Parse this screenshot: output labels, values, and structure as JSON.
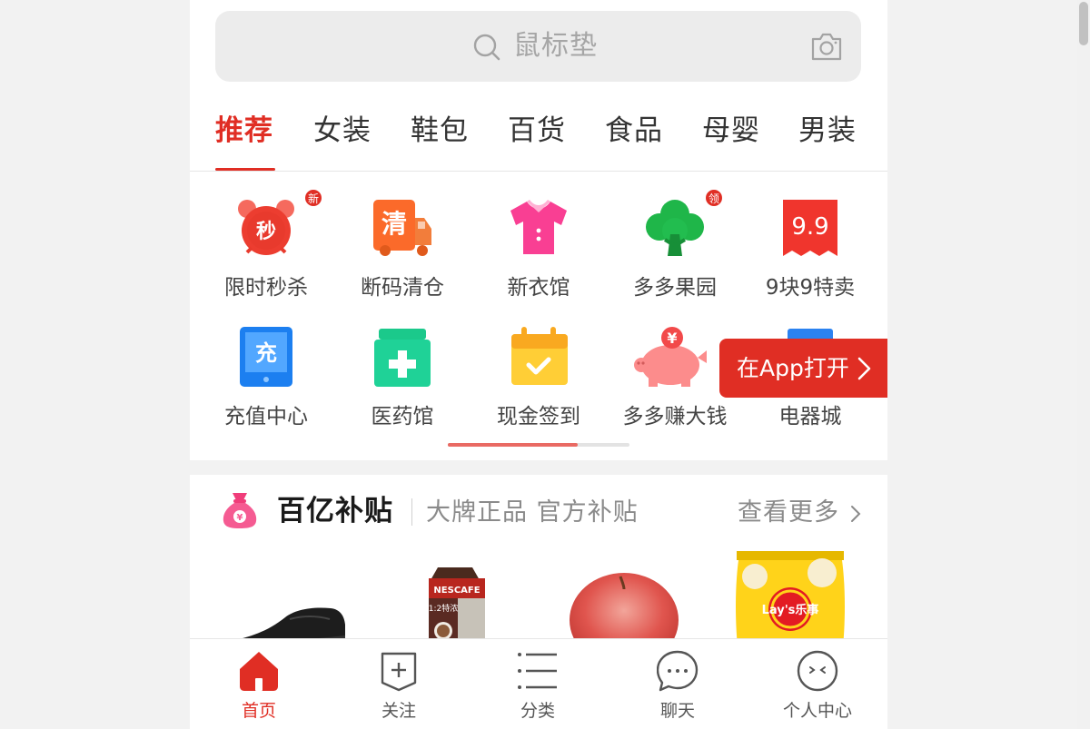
{
  "search": {
    "placeholder": "鼠标垫"
  },
  "tabs": [
    "推荐",
    "女装",
    "鞋包",
    "百货",
    "食品",
    "母婴",
    "男装"
  ],
  "grid": [
    {
      "label": "限时秒杀",
      "icon": "alarm-clock-icon",
      "icon_text": "秒",
      "badge": "新"
    },
    {
      "label": "断码清仓",
      "icon": "truck-icon",
      "icon_text": "清"
    },
    {
      "label": "新衣馆",
      "icon": "shirt-icon"
    },
    {
      "label": "多多果园",
      "icon": "tree-icon",
      "badge": "领"
    },
    {
      "label": "9块9特卖",
      "icon": "price-tag-icon",
      "icon_text": "9.9"
    },
    {
      "label": "充值中心",
      "icon": "phone-recharge-icon",
      "icon_text": "充"
    },
    {
      "label": "医药馆",
      "icon": "medicine-box-icon"
    },
    {
      "label": "现金签到",
      "icon": "calendar-check-icon"
    },
    {
      "label": "多多赚大钱",
      "icon": "piggy-bank-icon",
      "icon_text": "¥"
    },
    {
      "label": "电器城",
      "icon": "appliance-icon"
    }
  ],
  "grid_scroll_progress": 0.715,
  "open_app": {
    "label": "在App打开"
  },
  "subsidy": {
    "title": "百亿补贴",
    "tagline": "大牌正品 官方补贴",
    "more": "查看更多",
    "bag_symbol": "¥",
    "products": [
      {
        "name": "leather-shoe"
      },
      {
        "name": "coffee-pack",
        "brand": "NESCAFE",
        "sub": "1:2特浓"
      },
      {
        "name": "apple"
      },
      {
        "name": "potato-chips",
        "brand": "Lay's乐事"
      }
    ]
  },
  "bottom_nav": [
    {
      "label": "首页",
      "icon": "home-icon",
      "active": true
    },
    {
      "label": "关注",
      "icon": "follow-icon"
    },
    {
      "label": "分类",
      "icon": "category-list-icon"
    },
    {
      "label": "聊天",
      "icon": "chat-icon"
    },
    {
      "label": "个人中心",
      "icon": "profile-icon"
    }
  ],
  "colors": {
    "accent": "#e02e24",
    "background": "#f2f2f2"
  }
}
